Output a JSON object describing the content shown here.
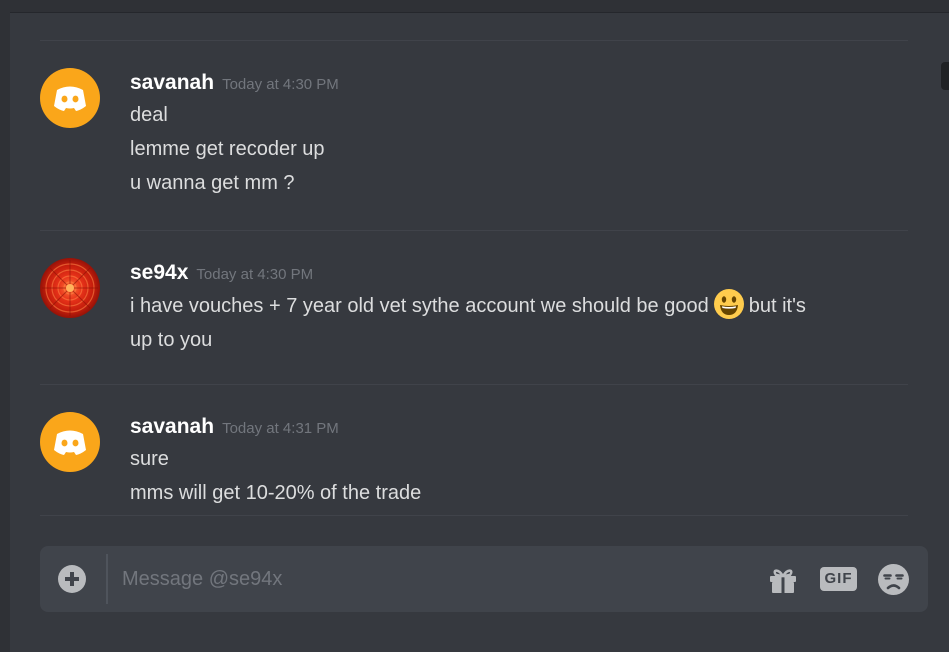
{
  "conversation": {
    "messages": [
      {
        "username": "savanah",
        "timestamp": "Today at 4:30 PM",
        "avatar_icon": "discord-logo-icon",
        "avatar_color": "#faa61a",
        "lines": [
          "deal",
          "lemme get recoder up",
          "u wanna get mm ?"
        ]
      },
      {
        "username": "se94x",
        "timestamp": "Today at 4:30 PM",
        "avatar_icon": "red-flower-avatar",
        "text_before_emoji": "i have vouches + 7 year old vet sythe account we should be good",
        "emoji": "smiley-emoji",
        "text_after_emoji": "but it's",
        "text_continued": "up to you"
      },
      {
        "username": "savanah",
        "timestamp": "Today at 4:31 PM",
        "avatar_icon": "discord-logo-icon",
        "avatar_color": "#faa61a",
        "lines": [
          "sure",
          "mms will get 10-20% of the trade"
        ]
      }
    ]
  },
  "composer": {
    "placeholder": "Message @se94x",
    "attach_icon": "plus-circle-icon",
    "gift_icon": "gift-icon",
    "gif_label": "GIF",
    "emoji_icon": "emoji-picker-icon"
  },
  "colors": {
    "background": "#36393f",
    "text": "#dcddde",
    "username": "#ffffff",
    "timestamp": "#72767d",
    "input_background": "#40444b",
    "icon": "#b9bbbe"
  }
}
